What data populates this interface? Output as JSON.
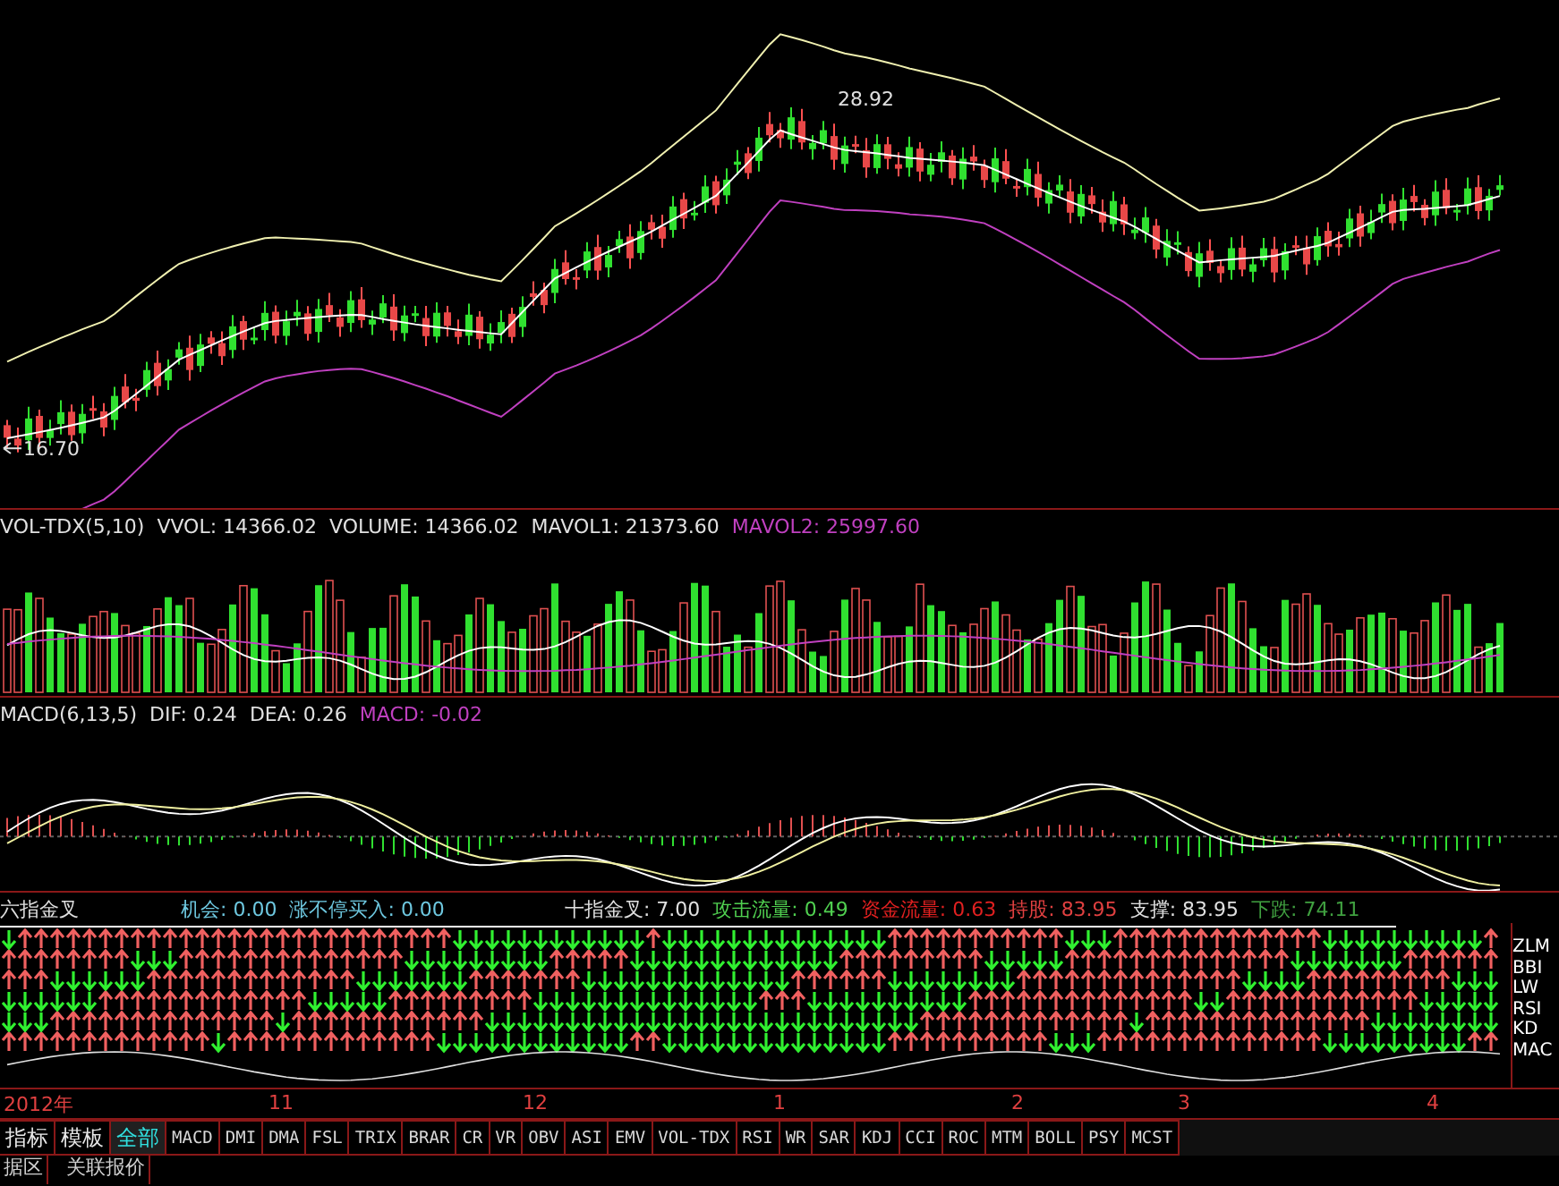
{
  "price_panel": {
    "high_label": "28.92",
    "low_label": "16.70"
  },
  "volume_panel": {
    "readings": [
      {
        "text": "VOL-TDX(5,10)",
        "color": "#e0e0e0"
      },
      {
        "text": "VVOL: 14366.02",
        "color": "#e0e0e0"
      },
      {
        "text": "VOLUME: 14366.02",
        "color": "#e0e0e0"
      },
      {
        "text": "MAVOL1: 21373.60",
        "color": "#e0e0e0"
      },
      {
        "text": "MAVOL2: 25997.60",
        "color": "#c040c0"
      }
    ]
  },
  "macd_panel": {
    "readings": [
      {
        "text": "MACD(6,13,5)",
        "color": "#e0e0e0"
      },
      {
        "text": "DIF: 0.24",
        "color": "#e0e0e0"
      },
      {
        "text": "DEA: 0.26",
        "color": "#e0e0e0"
      },
      {
        "text": "MACD: -0.02",
        "color": "#c040c0"
      }
    ]
  },
  "signal_panel": {
    "title": "六指金叉",
    "readings": [
      {
        "label": "机会:",
        "value": "0.00",
        "color": "#6ec8e0"
      },
      {
        "label": "涨不停买入:",
        "value": "0.00",
        "color": "#6ec8e0"
      },
      {
        "label": "十指金叉:",
        "value": "7.00",
        "color": "#e0e0e0"
      },
      {
        "label": "攻击流量:",
        "value": "0.49",
        "color": "#50d050"
      },
      {
        "label": "资金流量:",
        "value": "0.63",
        "color": "#e02020"
      },
      {
        "label": "持股:",
        "value": "83.95",
        "color": "#e04040"
      },
      {
        "label": "支撑:",
        "value": "83.95",
        "color": "#e0e0e0"
      },
      {
        "label": "下跌:",
        "value": "74.11",
        "color": "#40a040"
      }
    ],
    "row_labels": [
      "ZLM",
      "BBI",
      "LW",
      "RSI",
      "KD",
      "MAC"
    ]
  },
  "time_axis": [
    "2012年",
    "11",
    "12",
    "1",
    "2",
    "3",
    "4"
  ],
  "tabs": [
    {
      "label": "指标",
      "selected": false
    },
    {
      "label": "模板",
      "selected": false
    },
    {
      "label": "全部",
      "selected": true
    },
    {
      "label": "MACD",
      "selected": false
    },
    {
      "label": "DMI",
      "selected": false
    },
    {
      "label": "DMA",
      "selected": false
    },
    {
      "label": "FSL",
      "selected": false
    },
    {
      "label": "TRIX",
      "selected": false
    },
    {
      "label": "BRAR",
      "selected": false
    },
    {
      "label": "CR",
      "selected": false
    },
    {
      "label": "VR",
      "selected": false
    },
    {
      "label": "OBV",
      "selected": false
    },
    {
      "label": "ASI",
      "selected": false
    },
    {
      "label": "EMV",
      "selected": false
    },
    {
      "label": "VOL-TDX",
      "selected": false
    },
    {
      "label": "RSI",
      "selected": false
    },
    {
      "label": "WR",
      "selected": false
    },
    {
      "label": "SAR",
      "selected": false
    },
    {
      "label": "KDJ",
      "selected": false
    },
    {
      "label": "CCI",
      "selected": false
    },
    {
      "label": "ROC",
      "selected": false
    },
    {
      "label": "MTM",
      "selected": false
    },
    {
      "label": "BOLL",
      "selected": false
    },
    {
      "label": "PSY",
      "selected": false
    },
    {
      "label": "MCST",
      "selected": false
    }
  ],
  "bottom_tabs": [
    "据区",
    "关联报价"
  ]
}
